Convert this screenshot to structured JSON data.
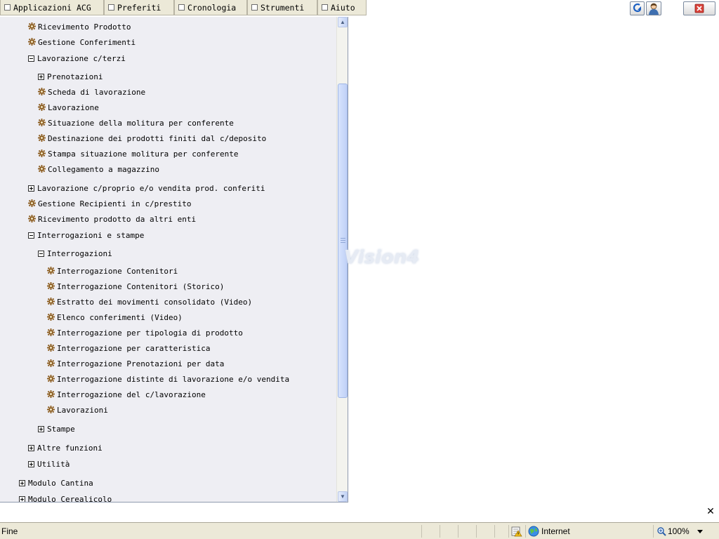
{
  "menu": {
    "items": [
      "Applicazioni ACG",
      "Preferiti",
      "Cronologia",
      "Strumenti",
      "Aiuto"
    ]
  },
  "tree": [
    {
      "label": "Ricevimento Prodotto",
      "icon": "gear-icon"
    },
    {
      "label": "Gestione Conferimenti",
      "icon": "gear-icon"
    },
    {
      "label": "Lavorazione c/terzi",
      "icon": "collapse-icon"
    },
    {
      "label": "Prenotazioni",
      "icon": "expand-icon"
    },
    {
      "label": "Scheda di lavorazione",
      "icon": "gear-icon"
    },
    {
      "label": "Lavorazione",
      "icon": "gear-icon"
    },
    {
      "label": "Situazione della molitura per conferente",
      "icon": "gear-icon"
    },
    {
      "label": "Destinazione dei prodotti finiti dal c/deposito",
      "icon": "gear-icon"
    },
    {
      "label": "Stampa situazione molitura per conferente",
      "icon": "gear-icon"
    },
    {
      "label": "Collegamento a magazzino",
      "icon": "gear-icon"
    },
    {
      "label": "Lavorazione c/proprio e/o vendita prod. conferiti",
      "icon": "expand-icon"
    },
    {
      "label": "Gestione Recipienti in c/prestito",
      "icon": "gear-icon"
    },
    {
      "label": "Ricevimento prodotto da altri enti",
      "icon": "gear-icon"
    },
    {
      "label": "Interrogazioni e stampe",
      "icon": "collapse-icon"
    },
    {
      "label": "Interrogazioni",
      "icon": "collapse-icon"
    },
    {
      "label": "Interrogazione Contenitori",
      "icon": "gear-icon"
    },
    {
      "label": "Interrogazione Contenitori (Storico)",
      "icon": "gear-icon"
    },
    {
      "label": "Estratto dei movimenti consolidato (Video)",
      "icon": "gear-icon"
    },
    {
      "label": "Elenco conferimenti (Video)",
      "icon": "gear-icon"
    },
    {
      "label": "Interrogazione per tipologia di prodotto",
      "icon": "gear-icon"
    },
    {
      "label": "Interrogazione per caratteristica",
      "icon": "gear-icon"
    },
    {
      "label": "Interrogazione Prenotazioni per data",
      "icon": "gear-icon"
    },
    {
      "label": "Interrogazione distinte di lavorazione e/o vendita",
      "icon": "gear-icon"
    },
    {
      "label": "Interrogazione del c/lavorazione",
      "icon": "gear-icon"
    },
    {
      "label": "Lavorazioni",
      "icon": "gear-icon"
    },
    {
      "label": "Stampe",
      "icon": "expand-icon"
    },
    {
      "label": "Altre funzioni",
      "icon": "expand-icon"
    },
    {
      "label": "Utilità",
      "icon": "expand-icon"
    },
    {
      "label": "Modulo Cantina",
      "icon": "expand-icon"
    },
    {
      "label": "Modulo Cerealicolo",
      "icon": "expand-icon"
    }
  ],
  "watermark": "Vision4",
  "status": {
    "text": "Fine",
    "zone": "Internet",
    "zoom": "100%"
  },
  "colors": {
    "panel_bg": "#eeeef3",
    "statusbar_bg": "#ece9d8",
    "gear": "#8a5a1c"
  }
}
